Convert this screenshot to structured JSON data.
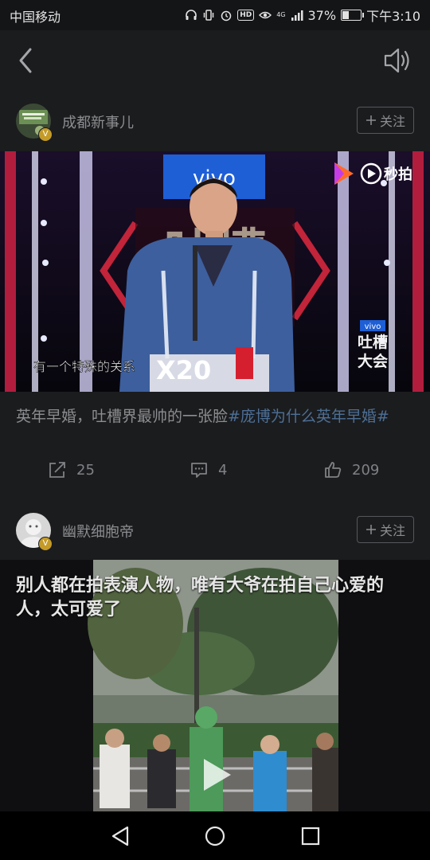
{
  "status": {
    "carrier": "中国移动",
    "network": "4G",
    "hd": "HD",
    "battery": "37%",
    "time": "下午3:10"
  },
  "topbar": {
    "back_icon": "back-arrow-icon",
    "sound_icon": "speaker-icon"
  },
  "posts": [
    {
      "author": "成都新事儿",
      "follow_label": "关注",
      "video": {
        "brand": "vivo",
        "watermark": "秒拍",
        "show_logo_text": [
          "vivo",
          "吐槽",
          "大会"
        ],
        "subtitle": "有一个特殊的关系",
        "product": "X20"
      },
      "caption_text": "英年早婚，吐槽界最帅的一张脸",
      "caption_tag": "#庞博为什么英年早婚#",
      "share_count": "25",
      "comment_count": "4",
      "like_count": "209"
    },
    {
      "author": "幽默细胞帝",
      "follow_label": "关注",
      "video_title": "别人都在拍表演人物，唯有大爷在拍自己心爱的人，太可爱了"
    }
  ],
  "colors": {
    "background": "#1b1c1e",
    "tag": "#4d6f96",
    "verified_badge": "#c49b27"
  }
}
